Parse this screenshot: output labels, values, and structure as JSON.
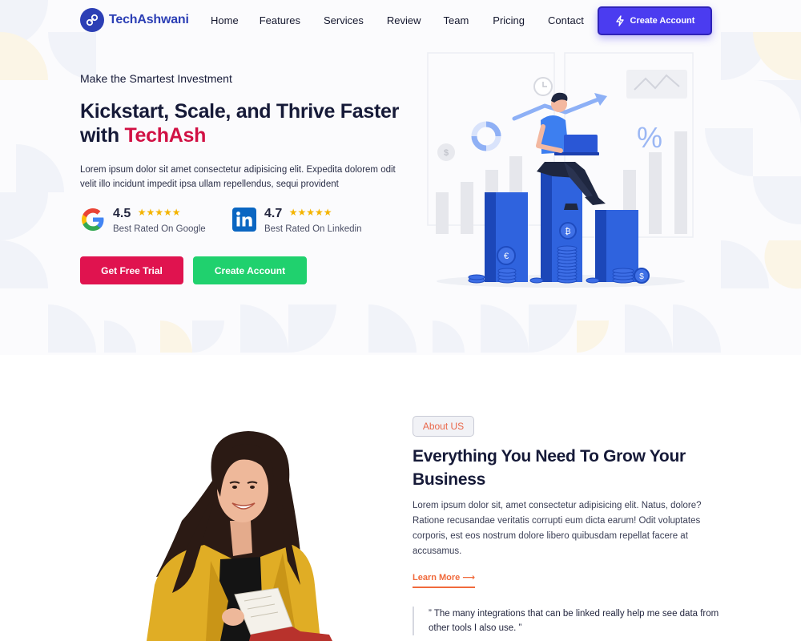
{
  "nav": {
    "brand": "TechAshwani",
    "links": [
      "Home",
      "Features",
      "Services",
      "Review",
      "Team",
      "Pricing",
      "Contact"
    ],
    "cta_label": "Create Account"
  },
  "hero": {
    "eyebrow": "Make the Smartest Investment",
    "title_line1": "Kickstart, Scale, and Thrive Faster",
    "title_line2_prefix": "with ",
    "title_accent": "TechAsh",
    "description": "Lorem ipsum dolor sit amet consectetur adipisicing elit. Expedita dolorem odit velit illo incidunt impedit ipsa ullam repellendus, sequi provident",
    "ratings": [
      {
        "score": "4.5",
        "stars": "★★★★★",
        "label": "Best Rated On Google",
        "icon": "google-icon"
      },
      {
        "score": "4.7",
        "stars": "★★★★★",
        "label": "Best Rated On Linkedin",
        "icon": "linkedin-icon"
      }
    ],
    "primary_button": "Get Free Trial",
    "secondary_button": "Create Account"
  },
  "about": {
    "tag": "About US",
    "title": "Everything You Need To Grow Your Business",
    "description": "Lorem ipsum dolor sit, amet consectetur adipisicing elit. Natus, dolore? Ratione recusandae veritatis corrupti eum dicta earum! Odit voluptates corporis, est eos nostrum dolore libero quibusdam repellat facere at accusamus.",
    "link_label": "Learn More ⟶",
    "quote": "” The many integrations that can be linked really help me see data from other tools I also use. ”"
  },
  "colors": {
    "brand": "#2c3fb5",
    "cta": "#4b3cf0",
    "accent_red": "#d11144",
    "trial_button": "#e0134f",
    "create_button": "#20d16e",
    "star": "#f4b400",
    "link_orange": "#f06a3c"
  }
}
